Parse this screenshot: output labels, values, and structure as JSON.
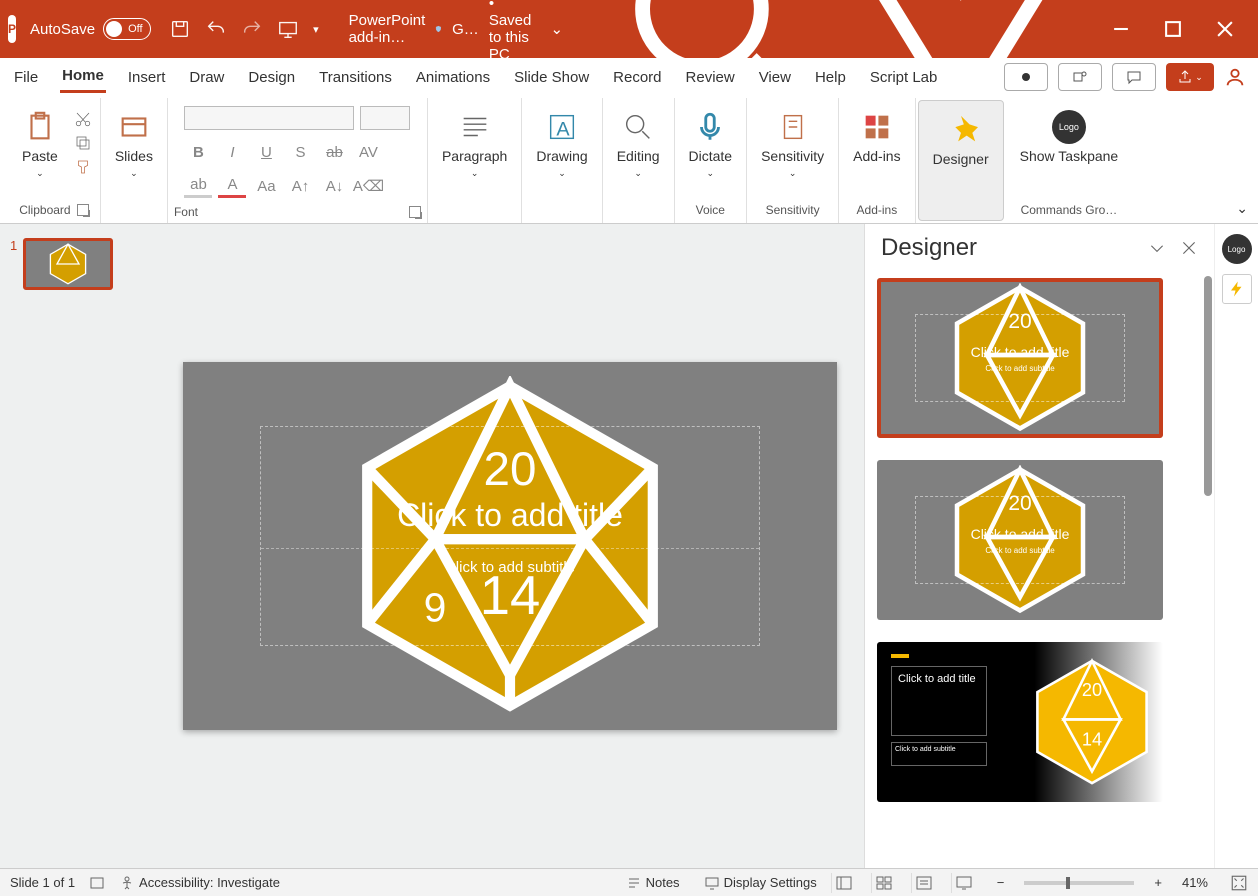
{
  "titlebar": {
    "autosave_label": "AutoSave",
    "autosave_value": "Off",
    "docname": "PowerPoint add-in…",
    "shield_text": "G…",
    "saved_text": "• Saved to this PC"
  },
  "tabs": [
    "File",
    "Home",
    "Insert",
    "Draw",
    "Design",
    "Transitions",
    "Animations",
    "Slide Show",
    "Record",
    "Review",
    "View",
    "Help",
    "Script Lab"
  ],
  "active_tab": "Home",
  "ribbon": {
    "clipboard": {
      "paste": "Paste",
      "label": "Clipboard"
    },
    "slides": {
      "slides": "Slides",
      "label": ""
    },
    "font": {
      "label": "Font"
    },
    "paragraph": {
      "btn": "Paragraph"
    },
    "drawing": {
      "btn": "Drawing"
    },
    "editing": {
      "btn": "Editing"
    },
    "voice": {
      "btn": "Dictate",
      "label": "Voice"
    },
    "sensitivity": {
      "btn": "Sensitivity",
      "label": "Sensitivity"
    },
    "addins": {
      "btn": "Add-ins",
      "label": "Add-ins"
    },
    "designer": {
      "btn": "Designer"
    },
    "commands": {
      "btn": "Show Taskpane",
      "label": "Commands Gro…",
      "logo": "Logo"
    }
  },
  "thumbnail": {
    "number": "1"
  },
  "slide": {
    "title_placeholder": "Click to add title",
    "subtitle_placeholder": "Click to add subtitle",
    "d20_top": "20",
    "d20_mid": "14"
  },
  "designer_pane": {
    "title": "Designer",
    "card1": {
      "t1": "Click to add title",
      "t2": "Click to add subtitle"
    },
    "card2": {
      "t1": "Click to add title",
      "t2": "Click to add subtitle"
    },
    "card3": {
      "t1": "Click to add title",
      "t2": "Click to add subtitle"
    }
  },
  "status": {
    "slide_info": "Slide 1 of 1",
    "accessibility": "Accessibility: Investigate",
    "notes": "Notes",
    "display": "Display Settings",
    "zoom": "41%"
  }
}
